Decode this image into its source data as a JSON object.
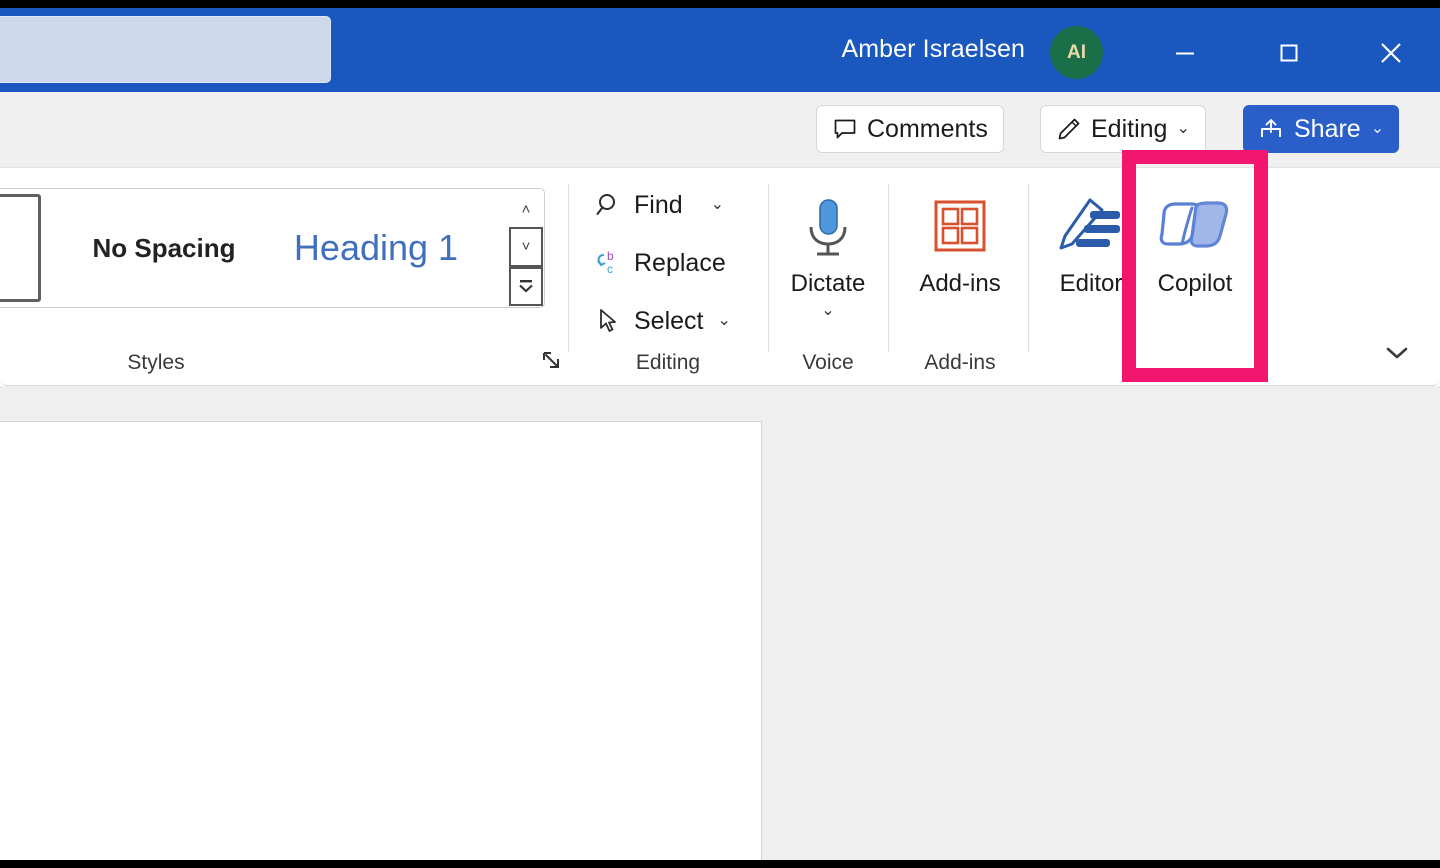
{
  "window": {
    "app": "Microsoft Word",
    "titlebar": {
      "search_value": "",
      "search_placeholder": "",
      "user_name": "Amber Israelsen",
      "avatar_initials": "AI",
      "avatar_color": "#1a6e48",
      "background_color": "#1a57bf",
      "minimize_icon": "minimize-icon",
      "maximize_icon": "maximize-icon",
      "close_icon": "close-icon"
    }
  },
  "command_bar": {
    "comments_label": "Comments",
    "comments_icon": "comment-icon",
    "editing_label": "Editing",
    "editing_icon": "pencil-icon",
    "editing_caret": "⌄",
    "share_label": "Share",
    "share_icon": "share-icon",
    "share_caret": "⌄",
    "share_color": "#2a5fc9"
  },
  "ribbon": {
    "collapse_caret": "⌄",
    "groups": [
      {
        "name": "Styles",
        "label": "Styles",
        "dialog_launcher": "styles-dialog-launcher",
        "gallery": {
          "items": [
            {
              "label": "",
              "preview": "partial-style"
            },
            {
              "label": "No Spacing",
              "preview": "no-spacing"
            },
            {
              "label": "Heading 1",
              "preview": "heading-1",
              "color": "#3f6fbd"
            }
          ],
          "scroll_up": "˄",
          "scroll_down": "˅",
          "more_styles": "˅"
        }
      },
      {
        "name": "Editing",
        "label": "Editing",
        "items": [
          {
            "label": "Find",
            "icon": "search-icon",
            "caret": "⌄"
          },
          {
            "label": "Replace",
            "icon": "replace-icon",
            "caret": ""
          },
          {
            "label": "Select",
            "icon": "cursor-icon",
            "caret": "⌄"
          }
        ]
      },
      {
        "name": "Voice",
        "label": "Voice",
        "items": [
          {
            "label": "Dictate",
            "icon": "microphone-icon",
            "caret": "⌄"
          }
        ]
      },
      {
        "name": "Add-ins",
        "label": "Add-ins",
        "items": [
          {
            "label": "Add-ins",
            "icon": "addins-grid-icon",
            "caret": ""
          }
        ]
      },
      {
        "name": "Editor-Copilot",
        "label": "",
        "items": [
          {
            "label": "Editor",
            "icon": "editor-pencil-icon",
            "caret": ""
          },
          {
            "label": "Copilot",
            "icon": "copilot-icon",
            "caret": ""
          }
        ]
      }
    ]
  },
  "highlight": {
    "target": "Copilot",
    "color": "#f2166e"
  },
  "document": {
    "page_background": "#ffffff",
    "canvas_background": "#efefef",
    "body_text": ""
  }
}
